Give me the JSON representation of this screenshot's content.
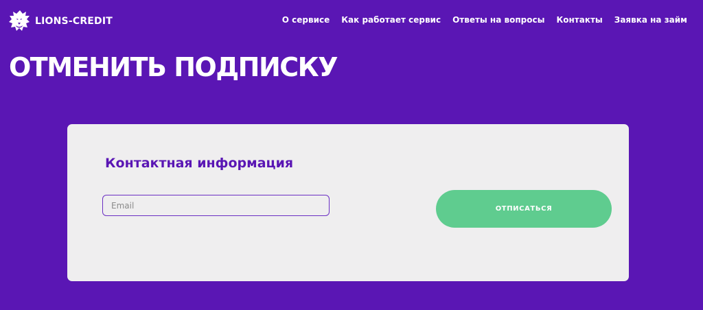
{
  "brand": {
    "name": "LIONS-CREDIT",
    "logo_icon": "lion-head-icon"
  },
  "nav": {
    "items": [
      {
        "label": "О сервисе"
      },
      {
        "label": "Как работает сервис"
      },
      {
        "label": "Ответы на вопросы"
      },
      {
        "label": "Контакты"
      },
      {
        "label": "Заявка на займ"
      }
    ]
  },
  "page": {
    "title": "ОТМЕНИТЬ ПОДПИСКУ"
  },
  "form": {
    "section_title": "Контактная информация",
    "email": {
      "value": "",
      "placeholder": "Email"
    },
    "submit_label": "ОТПИСАТЬСЯ"
  },
  "colors": {
    "background": "#5a16b4",
    "card": "#efeeef",
    "accent_green": "#5fcc8f",
    "heading_purple": "#5a16b4"
  }
}
